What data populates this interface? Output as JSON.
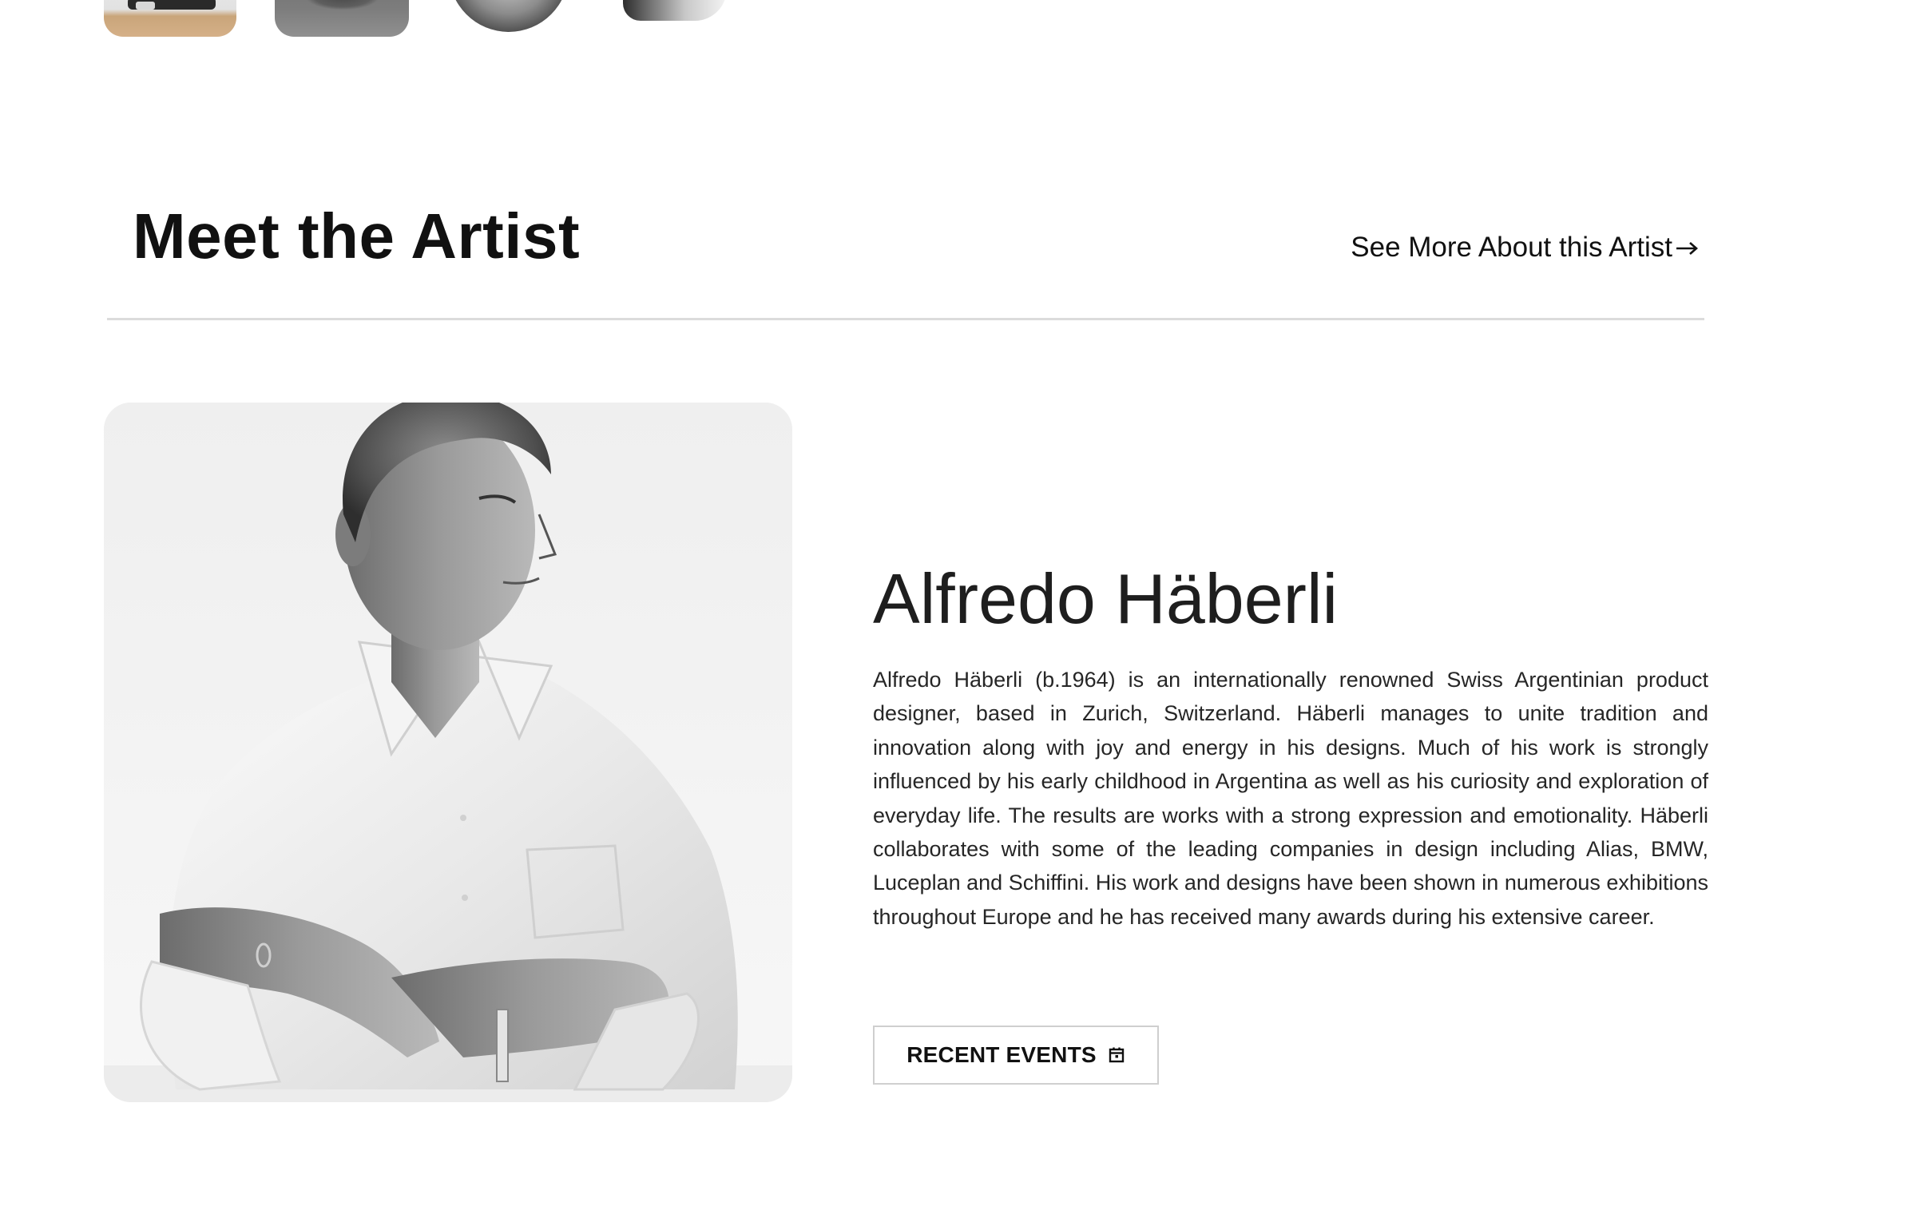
{
  "gallery": {
    "thumbnails": [
      {
        "icon": "studio-photo-thumbnail"
      },
      {
        "icon": "dark-bowl-thumbnail"
      },
      {
        "icon": "glass-bowl-thumbnail"
      },
      {
        "icon": "metal-bowl-thumbnail"
      }
    ]
  },
  "section": {
    "title": "Meet the Artist",
    "see_more_label": "See More About this Artist",
    "see_more_icon": "arrow-right-icon"
  },
  "artist": {
    "name": "Alfredo Häberli",
    "portrait_icon": "artist-portrait-photo",
    "bio": "Alfredo Häberli (b.1964) is an internationally renowned Swiss Argentinian product designer, based in Zurich, Switzerland. Häberli manages to unite tradition and innovation along with joy and energy in his designs. Much of his work is strongly influenced by his early childhood in Argentina as well as his curiosity and exploration of everyday life. The results are works with a strong expression and emotionality. Häberli collaborates with some of the leading companies in design including Alias, BMW, Luceplan and Schiffini. His work and designs have been shown in numerous exhibitions throughout Europe and he has received many awards during his extensive career.",
    "events_button_label": "RECENT EVENTS",
    "events_button_icon": "calendar-icon"
  },
  "colors": {
    "text": "#111111",
    "divider": "#dcdcdc",
    "button_border": "#cfcfcf",
    "background": "#ffffff"
  }
}
